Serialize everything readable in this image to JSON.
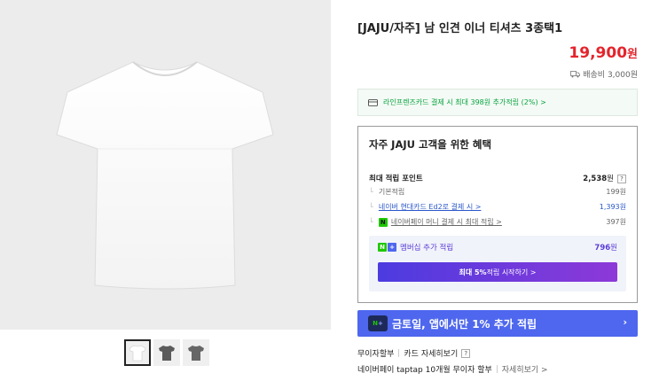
{
  "product": {
    "title": "[JAJU/자주] 남 인견 이너 티셔츠 3종택1",
    "price": "19,900",
    "price_unit": "원",
    "shipping": "배송비 3,000원"
  },
  "card_banner": {
    "text": "라인프렌즈카드 결제 시 최대 398원 추가적립 (2%) >"
  },
  "benefit": {
    "title": "자주 JAJU 고객을 위한 혜택",
    "max_label": "최대 적립 포인트",
    "max_value": "2,538",
    "max_unit": "원",
    "help": "?",
    "items": [
      {
        "label": "기본적립",
        "value": "199원"
      },
      {
        "label": "네이버 현대카드 Ed2로 결제 시 >",
        "value": "1,393원"
      },
      {
        "label": "네이버페이 머니 결제 시 최대 적립 >",
        "value": "397원"
      }
    ],
    "member_label": "멤버십 추가 적립",
    "member_value": "796",
    "member_unit": "원",
    "member_button_bold": "최대 5%",
    "member_button_rest": " 적립 시작하기 >"
  },
  "promo": {
    "text": "금토일, 앱에서만 1% 추가 적립",
    "arrow": "›"
  },
  "installment": {
    "line1_a": "무이자할부",
    "line1_b": "카드 자세히보기",
    "line1_help": "?",
    "line2_a": "네이버페이 taptap 10개월 무이자 할부",
    "line2_b": "자세히보기 >"
  },
  "colors": {
    "price": "#e4242c",
    "accent_green": "#07a43f",
    "promo_blue": "#4e67ee",
    "member_purple": "#5a3ed8"
  }
}
